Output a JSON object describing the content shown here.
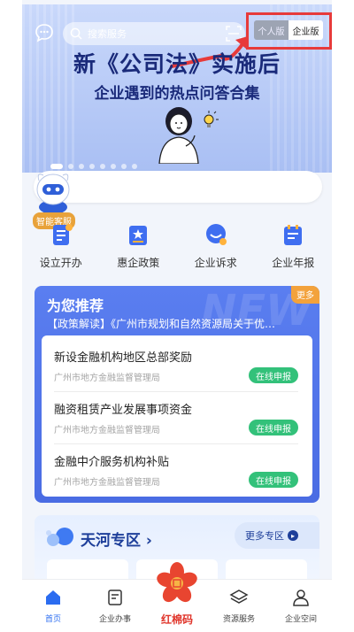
{
  "header": {
    "search_placeholder": "搜索服务",
    "toggle": {
      "personal": "个人版",
      "enterprise": "企业版",
      "selected": "enterprise"
    }
  },
  "banner": {
    "title_line1": "新《公司法》实施后",
    "title_line2": "企业遇到的热点问答合集",
    "dots_count": 8,
    "active_dot": 0
  },
  "assistant": {
    "badge": "智能客服"
  },
  "quick_menu": [
    {
      "label": "设立开办",
      "icon": "document-icon"
    },
    {
      "label": "惠企政策",
      "icon": "policy-icon"
    },
    {
      "label": "企业诉求",
      "icon": "smile-chat-icon"
    },
    {
      "label": "企业年报",
      "icon": "annual-report-icon"
    }
  ],
  "recommend": {
    "title": "为您推荐",
    "more": "更多",
    "watermark": "NEW",
    "marquee": "【政策解读】《广州市规划和自然资源局关于优…",
    "items": [
      {
        "name": "新设金融机构地区总部奖励",
        "dept": "广州市地方金融监督管理局",
        "action": "在线申报"
      },
      {
        "name": "融资租赁产业发展事项资金",
        "dept": "广州市地方金融监督管理局",
        "action": "在线申报"
      },
      {
        "name": "金融中介服务机构补贴",
        "dept": "广州市地方金融监督管理局",
        "action": "在线申报"
      }
    ]
  },
  "zone": {
    "title": "天河专区",
    "chevron": "›",
    "more": "更多专区"
  },
  "tabbar": [
    {
      "label": "首页",
      "icon": "home-icon",
      "active": true
    },
    {
      "label": "企业办事",
      "icon": "affairs-icon",
      "active": false
    },
    {
      "label": "红棉码",
      "icon": "kapok-flower-icon",
      "active": false
    },
    {
      "label": "资源服务",
      "icon": "layers-icon",
      "active": false
    },
    {
      "label": "企业空间",
      "icon": "user-icon",
      "active": false
    }
  ],
  "colors": {
    "primary": "#2b6cf0",
    "accent_orange": "#f3a23c",
    "green": "#33c17a",
    "highlight_red": "#e73a3a"
  }
}
